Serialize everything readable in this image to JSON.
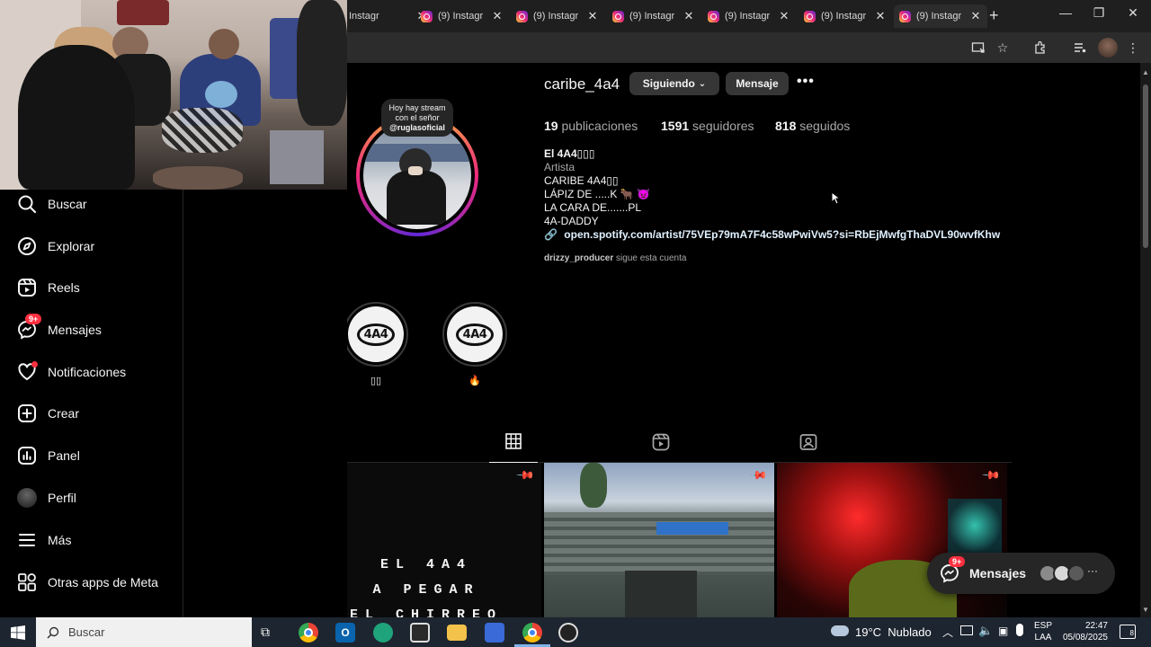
{
  "browser": {
    "tabs": [
      {
        "label": "Instagr"
      },
      {
        "label": "(9) Instagr"
      },
      {
        "label": "(9) Instagr"
      },
      {
        "label": "(9) Instagr"
      },
      {
        "label": "(9) Instagr"
      },
      {
        "label": "(9) Instagr"
      },
      {
        "label": "(9) Instagr"
      }
    ]
  },
  "webcam": {
    "note_line1": "Hoy hay stream",
    "note_line2": "con el señor",
    "note_handle": "@ruglasoficial"
  },
  "sidebar": {
    "items": [
      {
        "label": "Buscar",
        "icon": "search-icon"
      },
      {
        "label": "Explorar",
        "icon": "compass-icon"
      },
      {
        "label": "Reels",
        "icon": "reels-icon"
      },
      {
        "label": "Mensajes",
        "icon": "messenger-icon",
        "badge": "9+"
      },
      {
        "label": "Notificaciones",
        "icon": "heart-icon"
      },
      {
        "label": "Crear",
        "icon": "plus-square-icon"
      },
      {
        "label": "Panel",
        "icon": "dashboard-icon"
      },
      {
        "label": "Perfil",
        "icon": "avatar"
      },
      {
        "label": "Más",
        "icon": "menu-icon"
      },
      {
        "label": "Otras apps de Meta",
        "icon": "meta-apps-icon"
      }
    ]
  },
  "profile": {
    "username": "caribe_4a4",
    "follow_button": "Siguiendo",
    "message_button": "Mensaje",
    "more": "•••",
    "posts_count": "19",
    "posts_label": "publicaciones",
    "followers_count": "1591",
    "followers_label": "seguidores",
    "following_count": "818",
    "following_label": "seguidos",
    "name": "El 4A4▯▯▯",
    "category": "Artista",
    "bio": [
      "CARIBE 4A4▯▯",
      "LÁPIZ DE .....K 🐂 👿",
      "LA CARA DE.......PL",
      "4A-DADDY"
    ],
    "link": "open.spotify.com/artist/75VEp79mA7F4c58wPwiVw5?si=RbEjMwfgThaDVL90wvfKhw",
    "followed_by_user": "drizzy_producer",
    "followed_by_text": "sigue esta cuenta"
  },
  "highlights": [
    {
      "logo": "4A4",
      "label": "▯▯"
    },
    {
      "logo": "4A4",
      "label": "🔥"
    }
  ],
  "post1_text": [
    "EL 4A4",
    "A PEGAR",
    "EL CHIRREO"
  ],
  "messages_pill": {
    "label": "Mensajes",
    "badge": "9+"
  },
  "taskbar": {
    "search_placeholder": "Buscar",
    "weather": "19°C  Nublado",
    "lang_top": "ESP",
    "lang_bottom": "LAA",
    "time": "22:47",
    "date": "05/08/2025",
    "notif_count": "8"
  },
  "colors": {
    "accent_red": "#ff3040",
    "chrome_bg": "#1f1f1f",
    "taskbar": "#1d2530"
  }
}
